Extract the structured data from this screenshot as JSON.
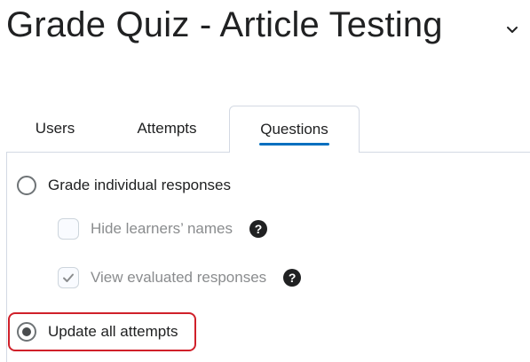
{
  "header": {
    "title": "Grade Quiz - Article Testing",
    "menu_icon": "chevron-down-icon"
  },
  "tabs": [
    {
      "label": "Users",
      "selected": false
    },
    {
      "label": "Attempts",
      "selected": false
    },
    {
      "label": "Questions",
      "selected": true
    }
  ],
  "options": {
    "grade_individual": {
      "label": "Grade individual responses",
      "selected": false
    },
    "hide_names": {
      "label": "Hide learners’ names",
      "checked": false,
      "disabled": true
    },
    "view_evaluated": {
      "label": "View evaluated responses",
      "checked": true,
      "disabled": true
    },
    "update_all": {
      "label": "Update all attempts",
      "selected": true
    }
  },
  "colors": {
    "accent": "#006fbf",
    "highlight": "#d0202a",
    "text": "#202122",
    "muted": "#8a8c8e"
  }
}
